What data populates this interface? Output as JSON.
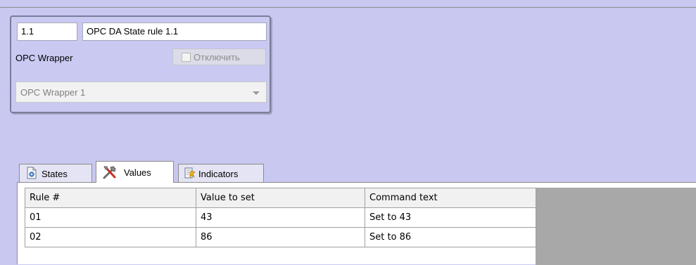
{
  "object_panel": {
    "id_value": "1.1",
    "name_value": "OPC DA State rule 1.1",
    "type_label": "OPC Wrapper",
    "disable_label": "Отключить",
    "disable_checked": false,
    "parent_select_value": "OPC Wrapper 1"
  },
  "tabs": [
    {
      "label": "States",
      "icon": "states-icon",
      "active": false
    },
    {
      "label": "Values",
      "icon": "values-tools-icon",
      "active": true
    },
    {
      "label": "Indicators",
      "icon": "indicators-icon",
      "active": false
    }
  ],
  "table": {
    "columns": [
      "Rule #",
      "Value to set",
      "Command text"
    ],
    "rows": [
      [
        "01",
        "43",
        "Set to 43"
      ],
      [
        "02",
        "86",
        "Set to 86"
      ]
    ]
  },
  "colors": {
    "background": "#c8c8f0",
    "panel_border": "#7c7c9a",
    "grid_empty": "#a8a8a8"
  }
}
